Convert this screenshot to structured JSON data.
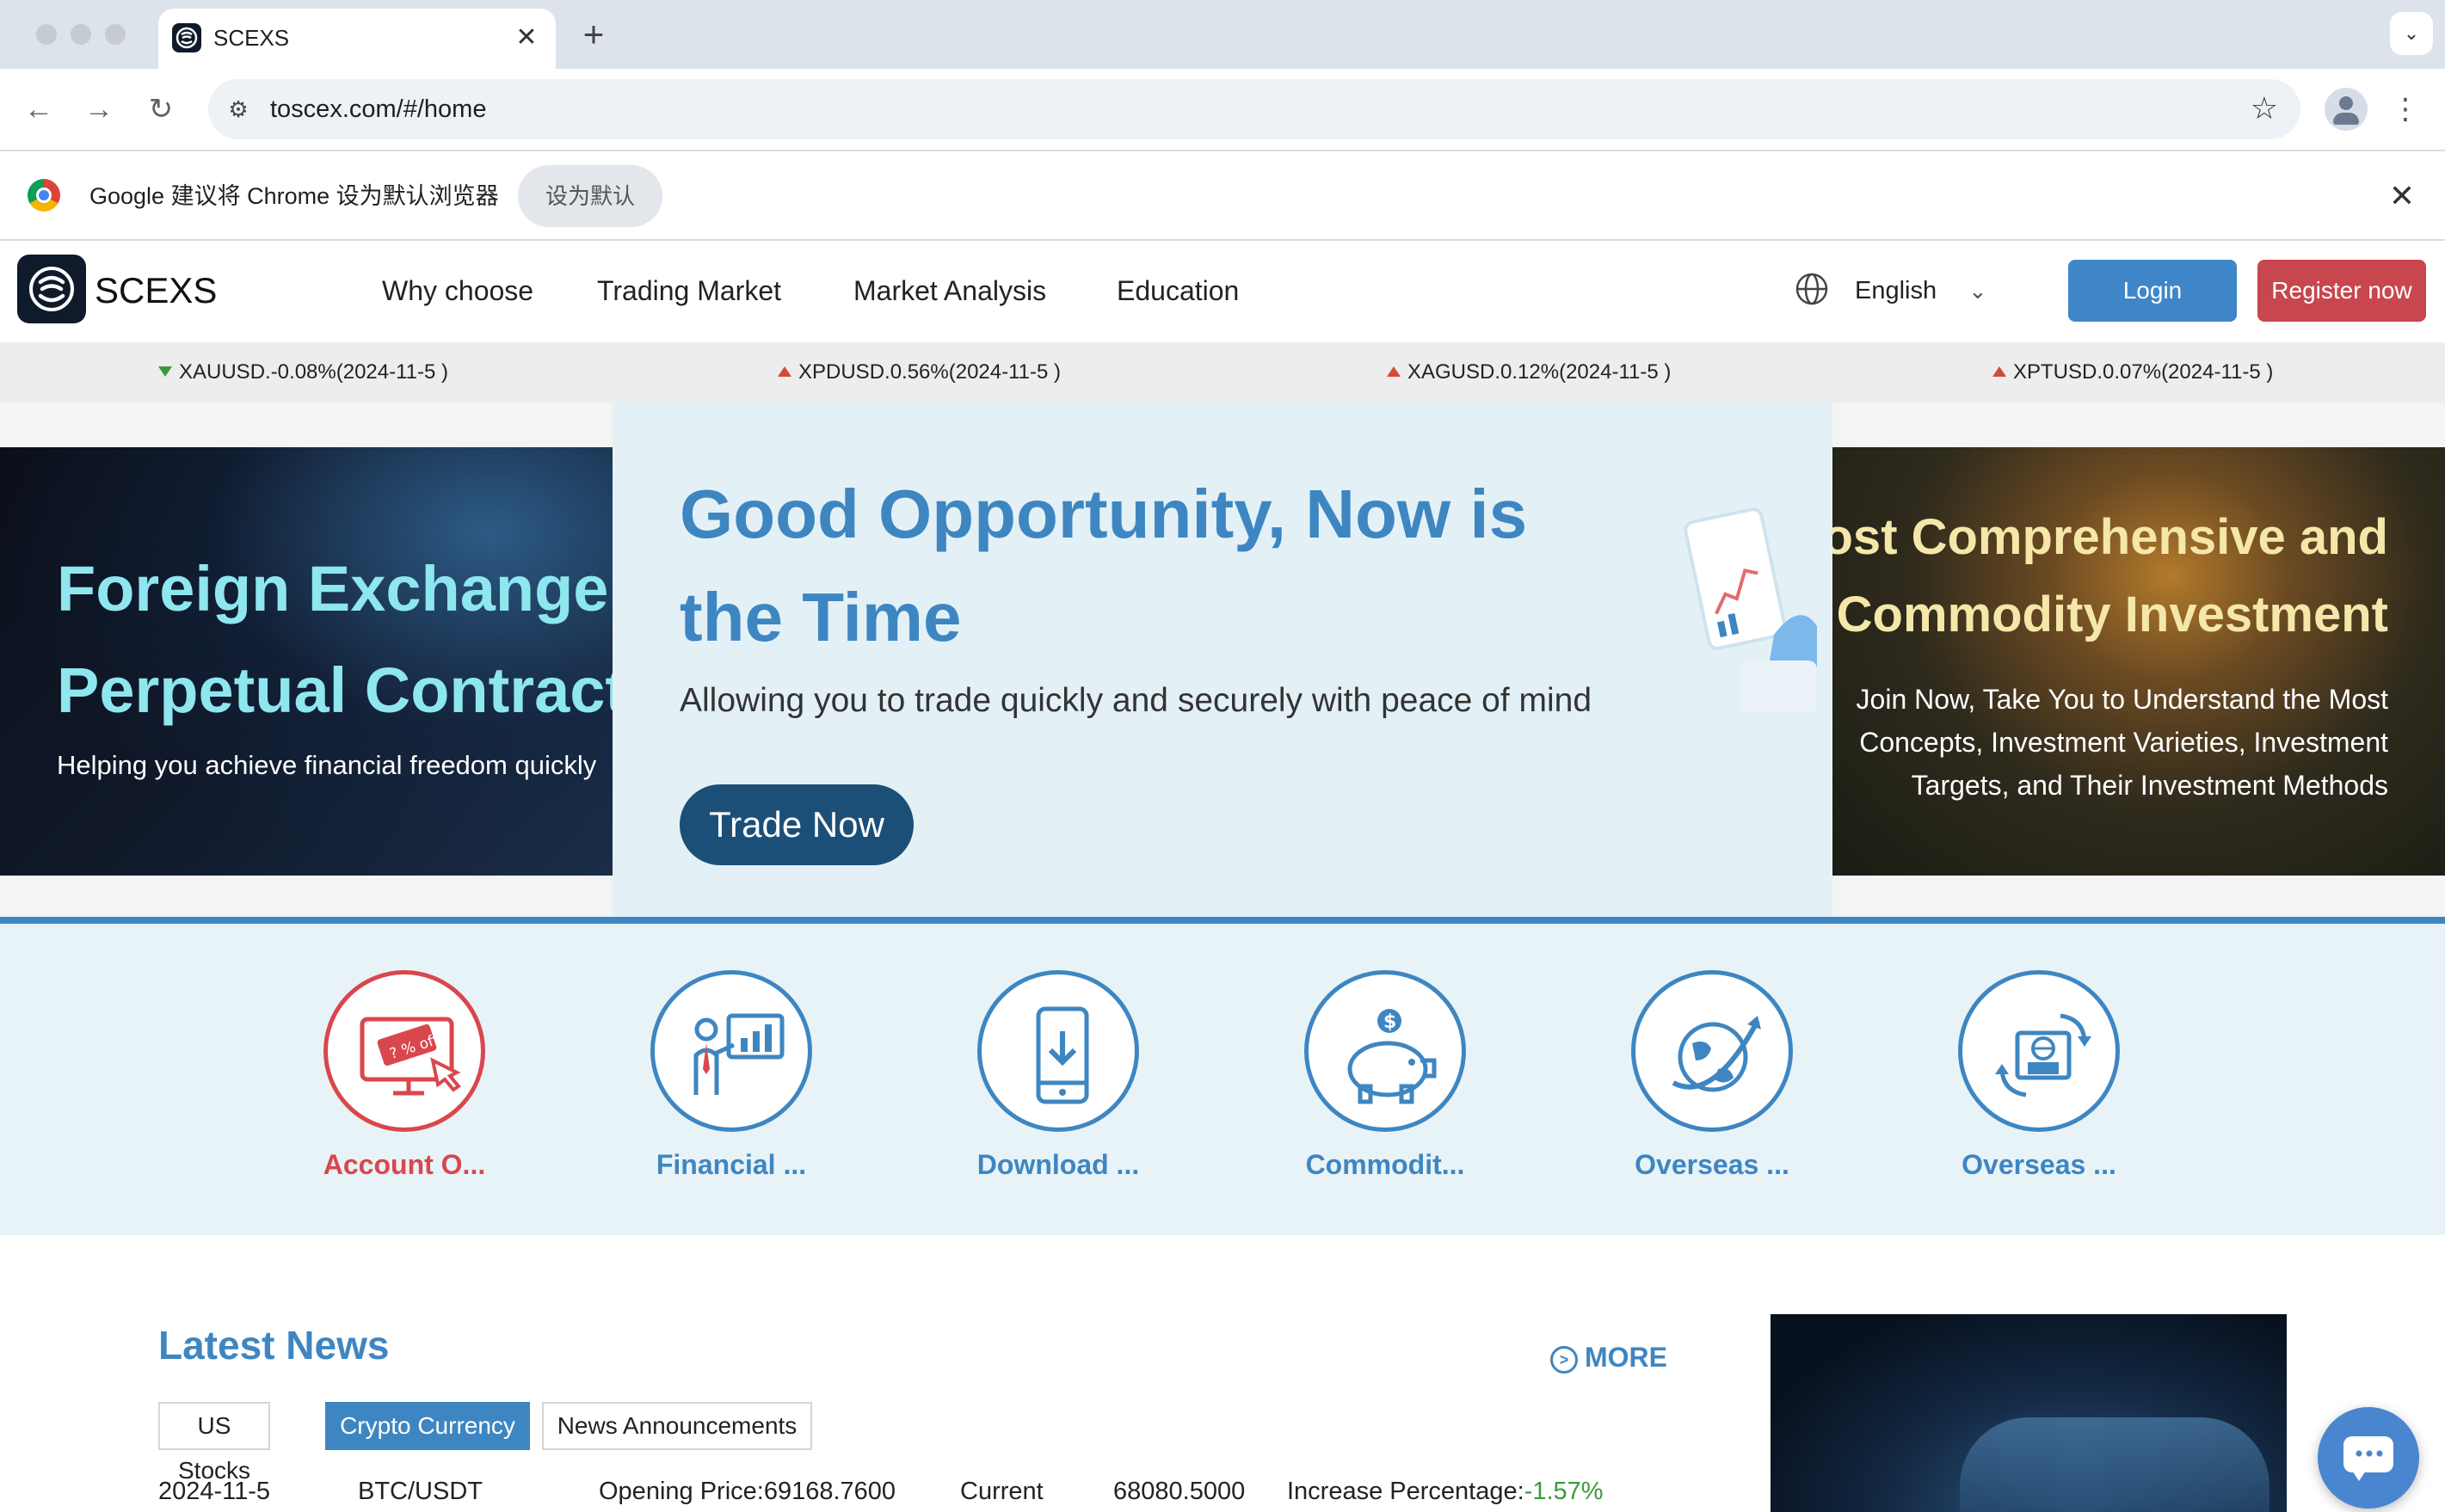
{
  "browser": {
    "tab_title": "SCEXS",
    "url": "toscex.com/#/home",
    "infobar_message": "Google 建议将 Chrome 设为默认浏览器",
    "infobar_button": "设为默认"
  },
  "site": {
    "logo_text": "SCEXS",
    "nav": [
      "Why choose",
      "Trading Market",
      "Market Analysis",
      "Education"
    ],
    "language": "English",
    "login_label": "Login",
    "register_label": "Register now",
    "accent_color": "#3e86c1",
    "danger_color": "#c8464e"
  },
  "ticker": [
    {
      "text": "XAUUSD.-0.08%(2024-11-5 )",
      "direction": "down"
    },
    {
      "text": "XPDUSD.0.56%(2024-11-5 )",
      "direction": "up"
    },
    {
      "text": "XAGUSD.0.12%(2024-11-5 )",
      "direction": "up"
    },
    {
      "text": "XPTUSD.0.07%(2024-11-5 )",
      "direction": "up"
    }
  ],
  "banner": {
    "left": {
      "line1": "Foreign Exchange",
      "line2": "Perpetual Contract",
      "sub": "Helping you achieve financial freedom quickly"
    },
    "center": {
      "title": "Good Opportunity, Now is the Time",
      "sub": "Allowing you to trade quickly and securely with peace of mind",
      "cta": "Trade Now"
    },
    "right": {
      "line1": "Most Comprehensive and",
      "line2": "Commodity Investment",
      "p1": "Join Now, Take You to Understand the Most",
      "p2": "Concepts, Investment Varieties, Investment",
      "p3": "Targets, and Their Investment Methods"
    }
  },
  "features": [
    {
      "label": "Account O...",
      "icon": "discount-screen-icon",
      "color": "red"
    },
    {
      "label": "Financial ...",
      "icon": "presentation-chart-icon",
      "color": "blue"
    },
    {
      "label": "Download ...",
      "icon": "phone-download-icon",
      "color": "blue"
    },
    {
      "label": "Commodit...",
      "icon": "piggy-bank-icon",
      "color": "blue"
    },
    {
      "label": "Overseas ...",
      "icon": "globe-plane-icon",
      "color": "blue"
    },
    {
      "label": "Overseas ...",
      "icon": "currency-exchange-icon",
      "color": "blue"
    }
  ],
  "news": {
    "title": "Latest News",
    "more": "MORE",
    "tabs": [
      "US Stocks",
      "Crypto Currency",
      "News Announcements"
    ],
    "active_tab": "Crypto Currency",
    "row": {
      "date": "2024-11-5",
      "pair": "BTC/USDT",
      "opening": "Opening Price:69168.7600",
      "current_label": "Current",
      "current_value": "68080.5000",
      "increase_label": "Increase Percentage:",
      "increase_value": "-1.57%"
    }
  }
}
